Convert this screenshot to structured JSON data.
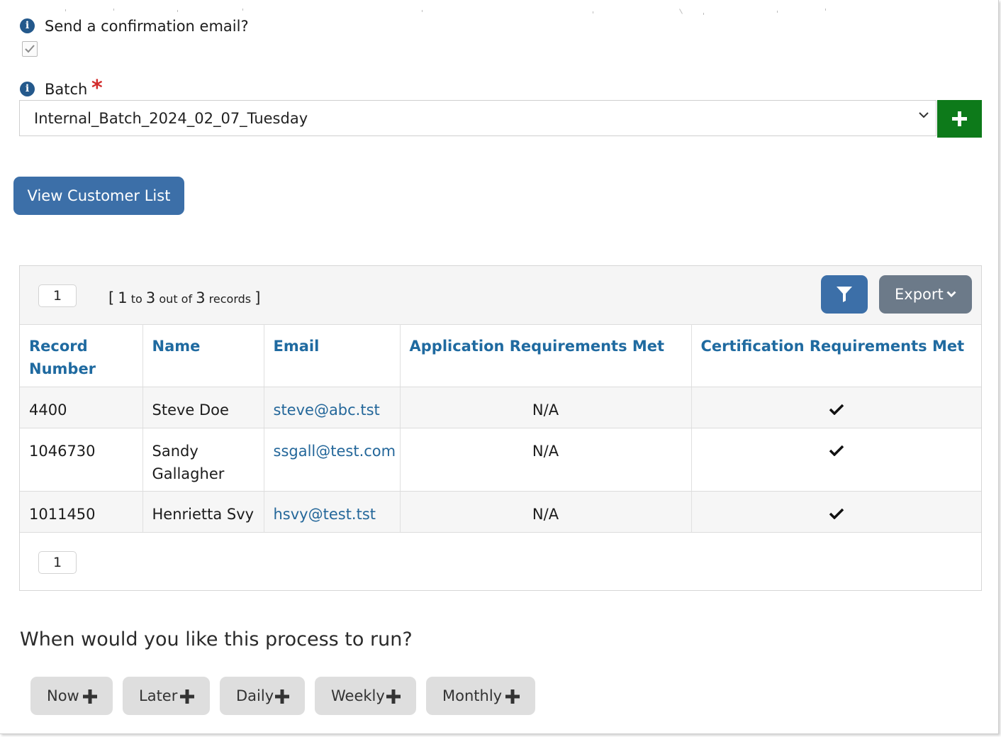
{
  "confirmation": {
    "label": "Send a confirmation email?",
    "checked": true
  },
  "batch": {
    "label": "Batch",
    "required_marker": "*",
    "selected_value": "Internal_Batch_2024_02_07_Tuesday"
  },
  "buttons": {
    "view_customer_list": "View Customer List",
    "export": "Export"
  },
  "pagination": {
    "current_page": "1",
    "range_open": "[",
    "range_start": "1",
    "range_to": "to",
    "range_end": "3",
    "range_out_of": "out of",
    "range_total": "3",
    "range_records": "records",
    "range_close": "]"
  },
  "table": {
    "headers": [
      "Record Number",
      "Name",
      "Email",
      "Application Requirements Met",
      "Certification Requirements Met"
    ],
    "rows": [
      {
        "record_number": "4400",
        "name": "Steve Doe",
        "email": "steve@abc.tst",
        "application_met": "N/A",
        "certification_met": true
      },
      {
        "record_number": "1046730",
        "name": "Sandy Gallagher",
        "email": "ssgall@test.com",
        "application_met": "N/A",
        "certification_met": true
      },
      {
        "record_number": "1011450",
        "name": "Henrietta Svy",
        "email": "hsvy@test.tst",
        "application_met": "N/A",
        "certification_met": true
      }
    ]
  },
  "schedule": {
    "question": "When would you like this process to run?",
    "options": [
      "Now",
      "Later",
      "Daily",
      "Weekly",
      "Monthly"
    ]
  },
  "colors": {
    "primary_blue": "#3c6fa8",
    "add_green": "#0d7a1a",
    "export_gray": "#6c7a89",
    "header_text_blue": "#1f6aa0",
    "required_red": "#d22b2b"
  },
  "icons": [
    "info-icon",
    "checkbox-check-icon",
    "chevron-down-icon",
    "plus-icon",
    "filter-icon",
    "check-icon"
  ]
}
